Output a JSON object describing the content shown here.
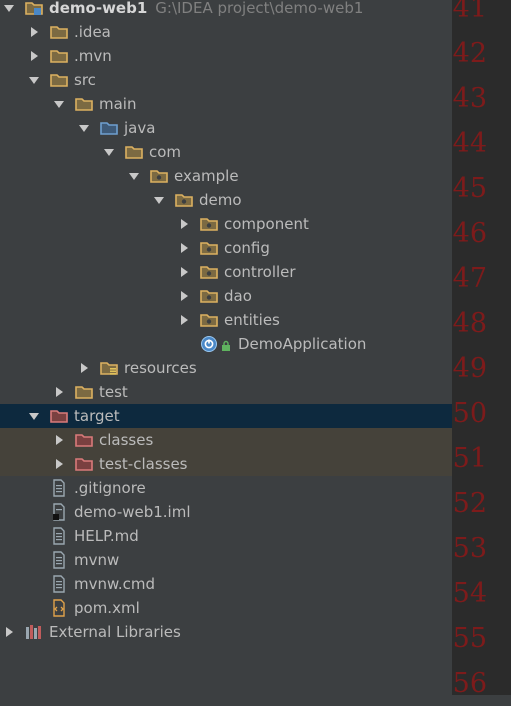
{
  "colors": {
    "background": "#3c3f41",
    "gutter": "#2b2b2b",
    "selected_row": "#0d293e",
    "excluded_row": "#45423a",
    "line_numbers": "#7d1b1b"
  },
  "tree": [
    {
      "label": "demo-web1",
      "path": "G:\\IDEA project\\demo-web1",
      "depth": 0,
      "arrow": "open",
      "icon": "module-folder-icon",
      "bold": true
    },
    {
      "label": ".idea",
      "depth": 1,
      "arrow": "closed",
      "icon": "folder-icon"
    },
    {
      "label": ".mvn",
      "depth": 1,
      "arrow": "closed",
      "icon": "folder-icon"
    },
    {
      "label": "src",
      "depth": 1,
      "arrow": "open",
      "icon": "folder-icon"
    },
    {
      "label": "main",
      "depth": 2,
      "arrow": "open",
      "icon": "folder-icon"
    },
    {
      "label": "java",
      "depth": 3,
      "arrow": "open",
      "icon": "source-folder-icon"
    },
    {
      "label": "com",
      "depth": 4,
      "arrow": "open",
      "icon": "folder-icon"
    },
    {
      "label": "example",
      "depth": 5,
      "arrow": "open",
      "icon": "package-icon"
    },
    {
      "label": "demo",
      "depth": 6,
      "arrow": "open",
      "icon": "package-icon"
    },
    {
      "label": "component",
      "depth": 7,
      "arrow": "closed",
      "icon": "package-icon"
    },
    {
      "label": "config",
      "depth": 7,
      "arrow": "closed",
      "icon": "package-icon"
    },
    {
      "label": "controller",
      "depth": 7,
      "arrow": "closed",
      "icon": "package-icon"
    },
    {
      "label": "dao",
      "depth": 7,
      "arrow": "closed",
      "icon": "package-icon"
    },
    {
      "label": "entities",
      "depth": 7,
      "arrow": "closed",
      "icon": "package-icon"
    },
    {
      "label": "DemoApplication",
      "depth": 7,
      "arrow": "none",
      "icon": "spring-boot-class-icon"
    },
    {
      "label": "resources",
      "depth": 3,
      "arrow": "closed",
      "icon": "resources-folder-icon"
    },
    {
      "label": "test",
      "depth": 2,
      "arrow": "closed",
      "icon": "folder-icon"
    },
    {
      "label": "target",
      "depth": 1,
      "arrow": "open",
      "icon": "excluded-folder-icon",
      "state": "selected"
    },
    {
      "label": "classes",
      "depth": 2,
      "arrow": "closed",
      "icon": "excluded-folder-icon",
      "state": "excluded"
    },
    {
      "label": "test-classes",
      "depth": 2,
      "arrow": "closed",
      "icon": "excluded-folder-icon",
      "state": "excluded"
    },
    {
      "label": ".gitignore",
      "depth": 1,
      "arrow": "none",
      "icon": "text-file-icon"
    },
    {
      "label": "demo-web1.iml",
      "depth": 1,
      "arrow": "none",
      "icon": "iml-file-icon"
    },
    {
      "label": "HELP.md",
      "depth": 1,
      "arrow": "none",
      "icon": "text-file-icon"
    },
    {
      "label": "mvnw",
      "depth": 1,
      "arrow": "none",
      "icon": "text-file-icon"
    },
    {
      "label": "mvnw.cmd",
      "depth": 1,
      "arrow": "none",
      "icon": "text-file-icon"
    },
    {
      "label": "pom.xml",
      "depth": 1,
      "arrow": "none",
      "icon": "xml-file-icon"
    },
    {
      "label": "External Libraries",
      "depth": 0,
      "arrow": "closed",
      "icon": "library-icon"
    }
  ],
  "line_numbers": [
    "41",
    "42",
    "43",
    "44",
    "45",
    "46",
    "47",
    "48",
    "49",
    "50",
    "51",
    "52",
    "53",
    "54",
    "55",
    "56"
  ]
}
